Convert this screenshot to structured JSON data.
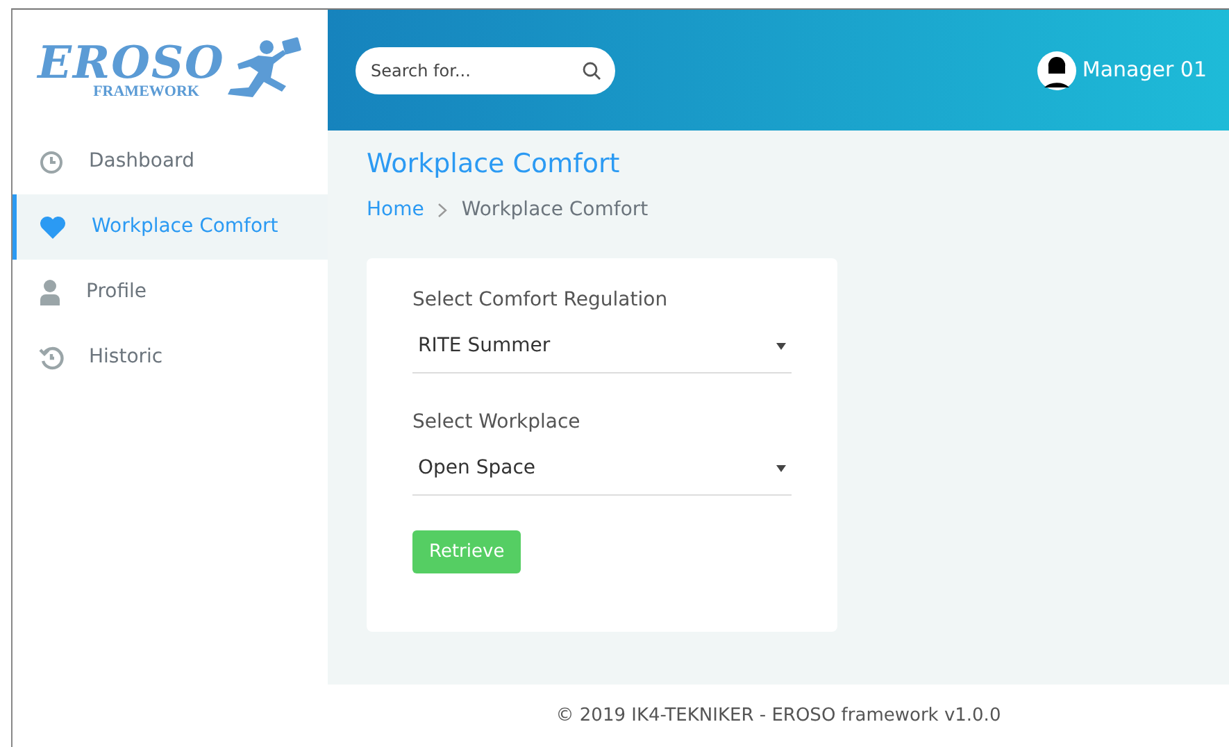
{
  "logo": {
    "title": "EROSO",
    "subtitle": "FRAMEWORK"
  },
  "sidebar": {
    "items": [
      {
        "label": "Dashboard",
        "kind": "clock",
        "selected": false
      },
      {
        "label": "Workplace Comfort",
        "kind": "heart",
        "selected": true
      },
      {
        "label": "Profile",
        "kind": "user",
        "selected": false
      },
      {
        "label": "Historic",
        "kind": "history",
        "selected": false
      }
    ]
  },
  "header": {
    "search": {
      "placeholder": "Search for..."
    },
    "user": "Manager 01"
  },
  "page": {
    "title": "Workplace Comfort",
    "breadcrumb": [
      {
        "label": "Home"
      },
      {
        "label": "Workplace Comfort"
      }
    ]
  },
  "form": {
    "fields": [
      {
        "label": "Select Comfort Regulation",
        "value": "RITE Summer"
      },
      {
        "label": "Select Workplace",
        "value": "Open Space"
      }
    ],
    "button": "Retrieve"
  },
  "footer": "© 2019 IK4-TEKNIKER - EROSO framework v1.0.0"
}
